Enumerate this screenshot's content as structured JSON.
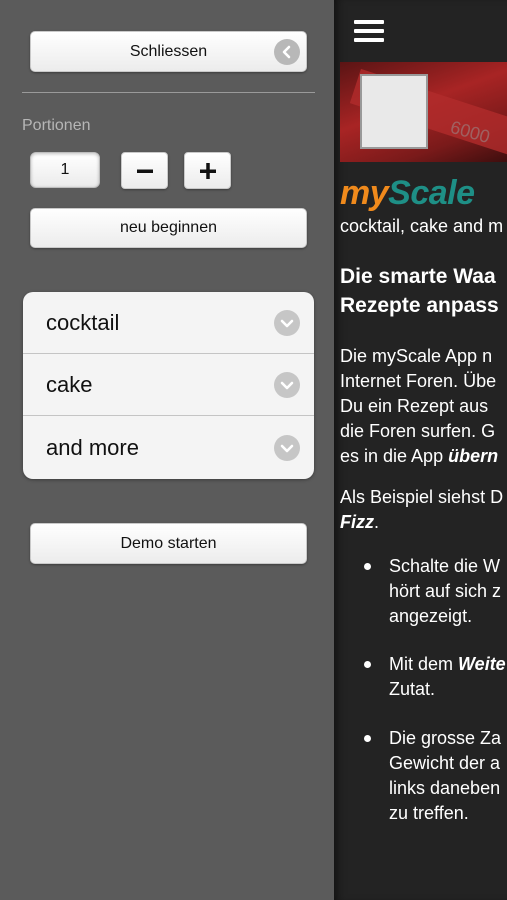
{
  "sidebar": {
    "close_label": "Schliessen",
    "portions_label": "Portionen",
    "portion_value": "1",
    "restart_label": "neu beginnen",
    "categories": [
      {
        "label": "cocktail"
      },
      {
        "label": "cake"
      },
      {
        "label": "and more"
      }
    ],
    "demo_label": "Demo starten",
    "icons": {
      "close": "close-circle-icon",
      "minus": "minus-icon",
      "plus": "plus-icon",
      "chevron": "chevron-down-circle-icon"
    }
  },
  "main": {
    "menu_icon": "hamburger-menu-icon",
    "logo_my": "my",
    "logo_scale": "Scale",
    "tagline": "cocktail, cake and m",
    "headline_line1": "Die smarte Waa",
    "headline_line2": "Rezepte anpass",
    "para1_lines": [
      "Die myScale App n",
      "Internet Foren. Übe",
      "Du ein Rezept aus",
      "die Foren surfen. G"
    ],
    "para1_last_prefix": "es in die App ",
    "para1_last_bold": "übern",
    "para2_line1": "Als Beispiel siehst D",
    "para2_bold": "Fizz",
    "para2_suffix": ".",
    "bullet1_lines": [
      "Schalte die W",
      "hört auf sich z",
      "angezeigt."
    ],
    "bullet2_prefix": "Mit dem ",
    "bullet2_bold": "Weite",
    "bullet2_line2": "Zutat.",
    "bullet3_lines": [
      "Die grosse Za",
      "Gewicht der a",
      "links daneben",
      "zu treffen."
    ]
  },
  "colors": {
    "logo_my": "#f08a1c",
    "logo_scale": "#1e8f86",
    "panel_bg": "#5b5b5b",
    "main_bg": "#232323"
  }
}
